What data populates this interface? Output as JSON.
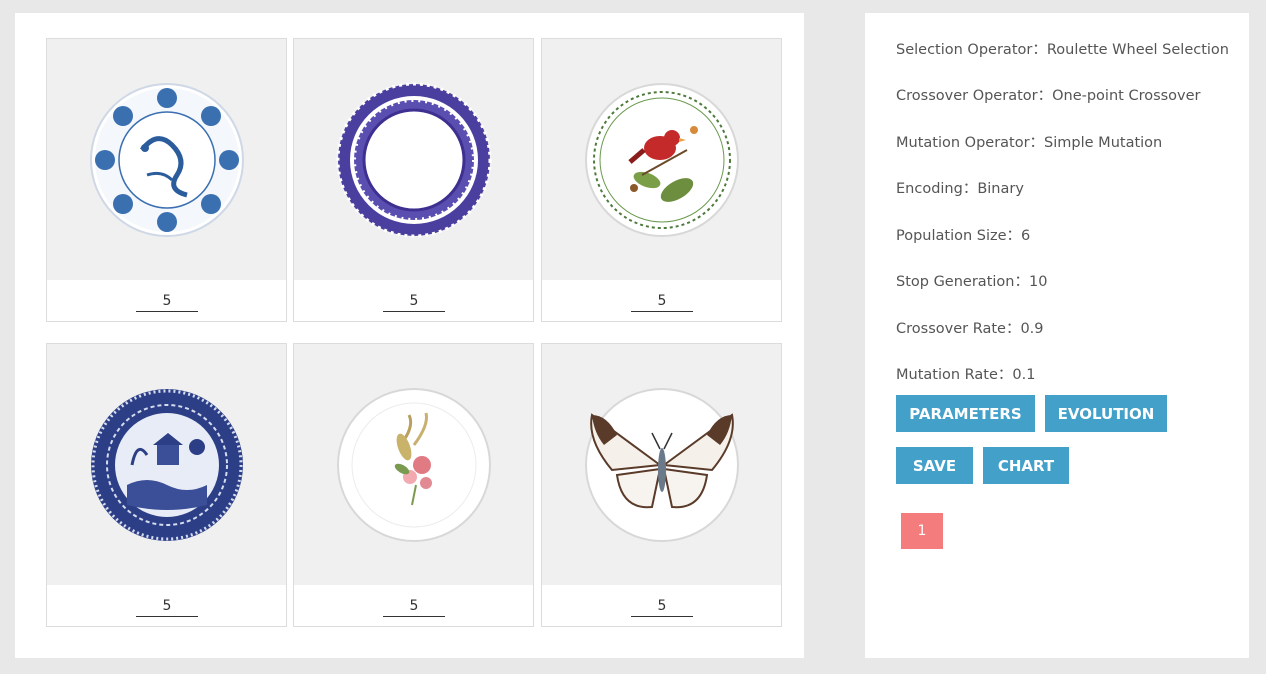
{
  "individuals": [
    {
      "score": "5",
      "plate": "dragon-blue-plate"
    },
    {
      "score": "5",
      "plate": "purple-lace-plate"
    },
    {
      "score": "5",
      "plate": "cardinal-bird-plate"
    },
    {
      "score": "5",
      "plate": "willow-blue-plate"
    },
    {
      "score": "5",
      "plate": "floral-bouquet-plate"
    },
    {
      "score": "5",
      "plate": "butterfly-plate"
    }
  ],
  "parameters": {
    "selection": "Selection Operator：Roulette Wheel Selection",
    "crossover": "Crossover Operator：One-point Crossover",
    "mutation": "Mutation Operator：Simple Mutation",
    "encoding": "Encoding：Binary",
    "population": "Population Size：6",
    "stop_generation": "Stop Generation：10",
    "crossover_rate": "Crossover Rate：0.9",
    "mutation_rate": "Mutation Rate：0.1"
  },
  "buttons": {
    "parameters": "PARAMETERS",
    "evolution": "EVOLUTION",
    "save": "SAVE",
    "chart": "CHART"
  },
  "pagination": {
    "current": "1"
  },
  "colors": {
    "button": "#42a0c9",
    "page_badge": "#f47c7c",
    "background": "#e8e8e8"
  }
}
